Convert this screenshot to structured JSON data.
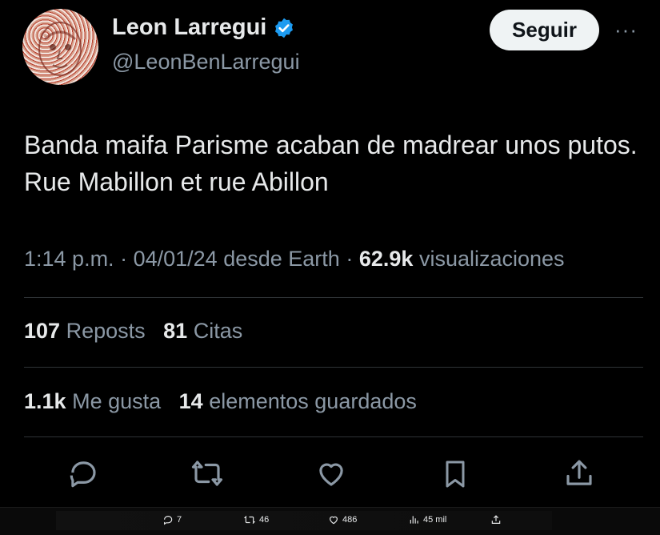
{
  "author": {
    "name": "Leon Larregui",
    "handle": "@LeonBenLarregui",
    "verified": true,
    "verified_color": "#1d9bf0"
  },
  "header": {
    "follow_label": "Seguir",
    "more_label": "···"
  },
  "tweet": {
    "text": "Banda maifa Parisme acaban de madrear unos putos. Rue Mabillon et rue Abillon"
  },
  "meta": {
    "time": "1:14 p.m.",
    "sep1": "·",
    "date": "04/01/24",
    "source": "desde Earth",
    "sep2": "·",
    "views_count": "62.9k",
    "views_label": "visualizaciones"
  },
  "stats": {
    "reposts_count": "107",
    "reposts_label": "Reposts",
    "quotes_count": "81",
    "quotes_label": "Citas",
    "likes_count": "1.1k",
    "likes_label": "Me gusta",
    "bookmarks_count": "14",
    "bookmarks_label": "elementos guardados"
  },
  "actions": [
    "reply-icon",
    "retweet-icon",
    "like-icon",
    "bookmark-icon",
    "share-icon"
  ],
  "bottom_bar": {
    "replies": "7",
    "retweets": "46",
    "likes": "486",
    "views": "45 mil"
  },
  "colors": {
    "background": "#000000",
    "text": "#e7e9ea",
    "muted": "#8b98a5",
    "divider": "#2f3336"
  }
}
